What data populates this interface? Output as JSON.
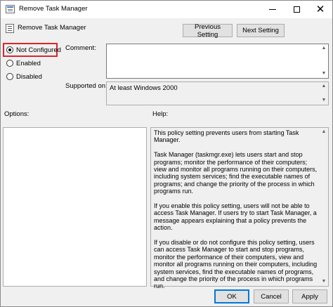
{
  "window": {
    "title": "Remove Task Manager",
    "close_glyph": "✕"
  },
  "header": {
    "title": "Remove Task Manager",
    "prev_label": "Previous Setting",
    "next_label": "Next Setting"
  },
  "state": {
    "options": [
      {
        "label": "Not Configured",
        "selected": true
      },
      {
        "label": "Enabled",
        "selected": false
      },
      {
        "label": "Disabled",
        "selected": false
      }
    ]
  },
  "comment": {
    "label": "Comment:",
    "value": ""
  },
  "supported": {
    "label": "Supported on:",
    "value": "At least Windows 2000"
  },
  "options_panel": {
    "label": "Options:"
  },
  "help": {
    "label": "Help:",
    "paragraphs": [
      "This policy setting prevents users from starting Task Manager.",
      "Task Manager (taskmgr.exe) lets users start and stop programs; monitor the performance of their computers; view and monitor all programs running on their computers, including system services; find the executable names of programs; and change the priority of the process in which programs run.",
      "If you enable this policy setting, users will not be able to access Task Manager. If users try to start Task Manager, a message appears explaining that a policy prevents the action.",
      "If you disable or do not configure this policy setting, users can access Task Manager to  start and stop programs, monitor the performance of their computers, view and monitor all programs running on their computers, including system services, find the executable names of programs, and change the priority of the process in which programs run."
    ]
  },
  "footer": {
    "ok_label": "OK",
    "cancel_label": "Cancel",
    "apply_label": "Apply"
  },
  "colors": {
    "highlight": "#d9262c",
    "ok_border": "#0078d7"
  }
}
